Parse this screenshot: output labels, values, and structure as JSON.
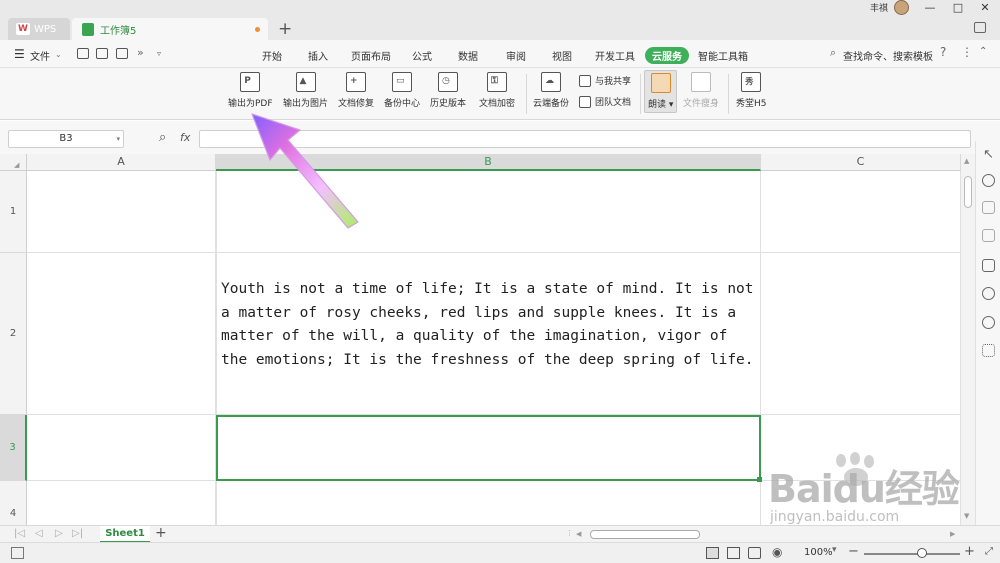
{
  "titlebar": {
    "wps_tab": "WPS",
    "doc_tab": "工作簿5",
    "new_tab": "+",
    "user_name": "丰祺",
    "win_min": "—",
    "win_max": "□",
    "win_close": "✕"
  },
  "menubar": {
    "file_label": "文件",
    "tabs": [
      "开始",
      "插入",
      "页面布局",
      "公式",
      "数据",
      "审阅",
      "视图",
      "开发工具",
      "云服务",
      "智能工具箱"
    ],
    "active_tab": "云服务",
    "search_label": "查找命令、搜索模板"
  },
  "ribbon": {
    "buttons": [
      {
        "label": "输出为PDF",
        "icon": "export-pdf-icon",
        "mark": "P"
      },
      {
        "label": "输出为图片",
        "icon": "export-image-icon",
        "mark": "▲"
      },
      {
        "label": "文档修复",
        "icon": "repair-icon",
        "mark": "+"
      },
      {
        "label": "备份中心",
        "icon": "backup-icon",
        "mark": "▭"
      },
      {
        "label": "历史版本",
        "icon": "history-icon",
        "mark": "◷"
      },
      {
        "label": "文档加密",
        "icon": "encrypt-icon",
        "mark": "⚿"
      },
      {
        "label": "云端备份",
        "icon": "cloud-backup-icon",
        "mark": "☁"
      }
    ],
    "share_label": "与我共享",
    "team_label": "团队文档",
    "read_label": "朗读",
    "slim_label": "文件瘦身",
    "h5_label": "秀堂H5",
    "h5_mark": "秀"
  },
  "formula": {
    "name_box": "B3",
    "fx": "fx",
    "value": ""
  },
  "grid": {
    "columns": [
      "A",
      "B",
      "C"
    ],
    "rows": [
      "1",
      "2",
      "3",
      "4"
    ],
    "selected_column": "B",
    "selected_row": "3",
    "b2_text": "Youth is not a time of life; It is a state of mind. It is not a matter of rosy cheeks, red lips and supple knees. It is a matter of the will, a quality of the imagination, vigor of the emotions; It is the freshness of the deep spring of life."
  },
  "sheets": {
    "tabs": [
      "Sheet1"
    ],
    "add": "+"
  },
  "status": {
    "zoom": "100%",
    "zoom_level": 0.6
  },
  "watermark": {
    "brand": "Baidu经验",
    "url": "jingyan.baidu.com"
  }
}
